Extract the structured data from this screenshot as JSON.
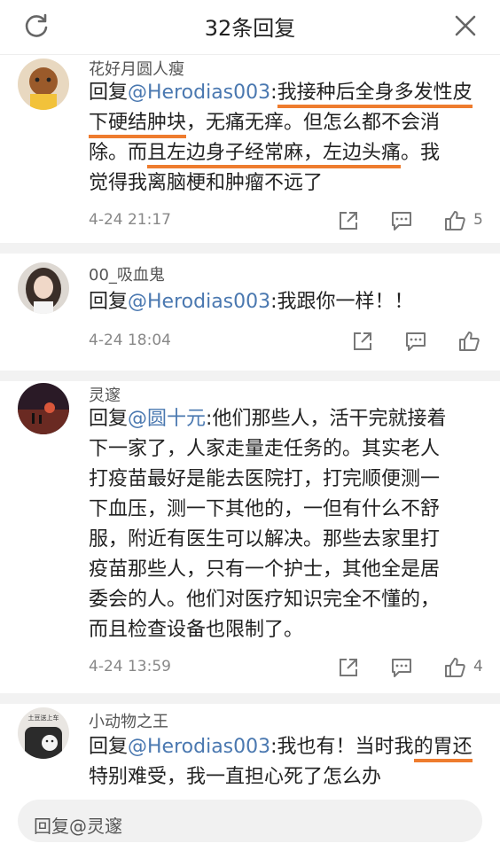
{
  "header": {
    "title": "32条回复",
    "refresh_icon": "refresh-icon",
    "close_icon": "close-icon"
  },
  "comments": [
    {
      "username": "花好月圆人瘦",
      "prefix": "回复",
      "mention": "@Herodias003",
      "lines": [
        [
          {
            "t": ":"
          },
          {
            "t": "我接种后全身多发性皮",
            "h": true
          }
        ],
        [
          {
            "t": "下硬结肿块",
            "h": true
          },
          {
            "t": "，无痛无痒。但怎么都不会消"
          }
        ],
        [
          {
            "t": "除。而"
          },
          {
            "t": "且左边身子经常麻，左边头痛",
            "h": true
          },
          {
            "t": "。我"
          }
        ],
        [
          {
            "t": "觉得我离脑梗和肿瘤不远了"
          }
        ]
      ],
      "time": "4-24 21:17",
      "likes": "5"
    },
    {
      "username": "00_吸血鬼",
      "prefix": "回复",
      "mention": "@Herodias003",
      "lines": [
        [
          {
            "t": ":我跟你一样！！"
          }
        ]
      ],
      "time": "4-24 18:04",
      "likes": ""
    },
    {
      "username": "灵邃",
      "prefix": "回复",
      "mention": "@圆十元",
      "lines": [
        [
          {
            "t": ":他们那些人，活干完就接着"
          }
        ],
        [
          {
            "t": "下一家了，人家走量走任务的。其实老人"
          }
        ],
        [
          {
            "t": "打疫苗最好是能去医院打，打完顺便测一"
          }
        ],
        [
          {
            "t": "下血压，测一下其他的，一但有什么不舒"
          }
        ],
        [
          {
            "t": "服，附近有医生可以解决。那些去家里打"
          }
        ],
        [
          {
            "t": "疫苗那些人，只有一个护士，其他全是居"
          }
        ],
        [
          {
            "t": "委会的人。他们对医疗知识完全不懂的，"
          }
        ],
        [
          {
            "t": "而且检查设备也限制了。"
          }
        ]
      ],
      "time": "4-24 13:59",
      "likes": "4"
    },
    {
      "username": "小动物之王",
      "prefix": "回复",
      "mention": "@Herodias003",
      "avatar_text": "土豆送上车",
      "lines": [
        [
          {
            "t": ":我也有！当时我"
          },
          {
            "t": "的胃还",
            "h": true
          }
        ],
        [
          {
            "t": "特别难受",
            "h": true
          },
          {
            "t": "，我一直担心死了怎么办"
          }
        ]
      ],
      "time": "",
      "likes": ""
    }
  ],
  "actions": {
    "share_icon": "share-icon",
    "comment_icon": "comment-icon",
    "like_icon": "thumbs-up-icon"
  },
  "reply": {
    "placeholder": "回复@灵邃"
  },
  "colors": {
    "mention": "#4a78b0",
    "highlight": "#ee7c2e",
    "separator": "#f2f2f2"
  }
}
